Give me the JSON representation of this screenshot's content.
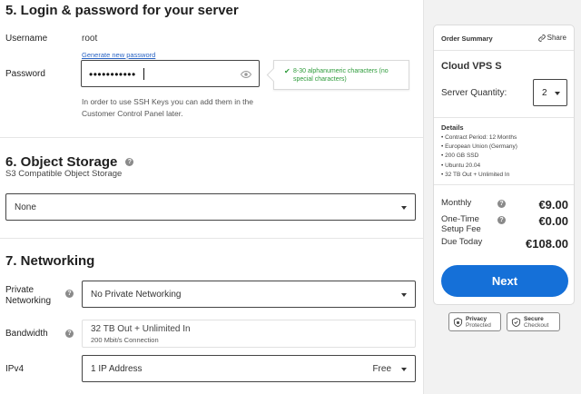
{
  "login": {
    "title": "5. Login & password for your server",
    "username_label": "Username",
    "username_value": "root",
    "generate_link": "Generate new password",
    "password_label": "Password",
    "password_mask": "•••••••••••",
    "tooltip": "8-30 alphanumeric characters (no special characters)",
    "ssh_help": "In order to use SSH Keys you can add them in the Customer Control Panel later."
  },
  "storage": {
    "title": "6. Object Storage",
    "subtitle": "S3 Compatible Object Storage",
    "selected": "None"
  },
  "networking": {
    "title": "7. Networking",
    "private_label": "Private Networking",
    "private_selected": "No Private Networking",
    "bandwidth_label": "Bandwidth",
    "bandwidth_value": "32 TB Out + Unlimited In",
    "bandwidth_sub": "200 Mbit/s Connection",
    "ipv4_label": "IPv4",
    "ipv4_selected": "1 IP Address",
    "ipv4_price": "Free"
  },
  "summary": {
    "header": "Order Summary",
    "share_label": "Share",
    "product": "Cloud VPS S",
    "quantity_label": "Server Quantity:",
    "quantity_value": "2",
    "details_header": "Details",
    "details": [
      "Contract Period: 12 Months",
      "European Union (Germany)",
      "200 GB SSD",
      "Ubuntu 20.04",
      "32 TB Out + Unlimited In"
    ],
    "monthly_label": "Monthly",
    "monthly_value": "€9.00",
    "setup_label": "One-Time Setup Fee",
    "setup_value": "€0.00",
    "due_label": "Due Today",
    "due_value": "€108.00",
    "next_label": "Next"
  },
  "badges": {
    "privacy_title": "Privacy",
    "privacy_sub": "Protected",
    "secure_title": "Secure",
    "secure_sub": "Checkout"
  },
  "colors": {
    "accent": "#1570d8",
    "success": "#2d9b3a",
    "link": "#2a64c4"
  },
  "icons": {
    "help": "question-circle-icon",
    "eye": "eye-icon",
    "check": "check-icon",
    "share": "share-icon",
    "dropdown": "chevron-down-icon",
    "privacy": "shield-icon",
    "secure": "shield-check-icon"
  }
}
